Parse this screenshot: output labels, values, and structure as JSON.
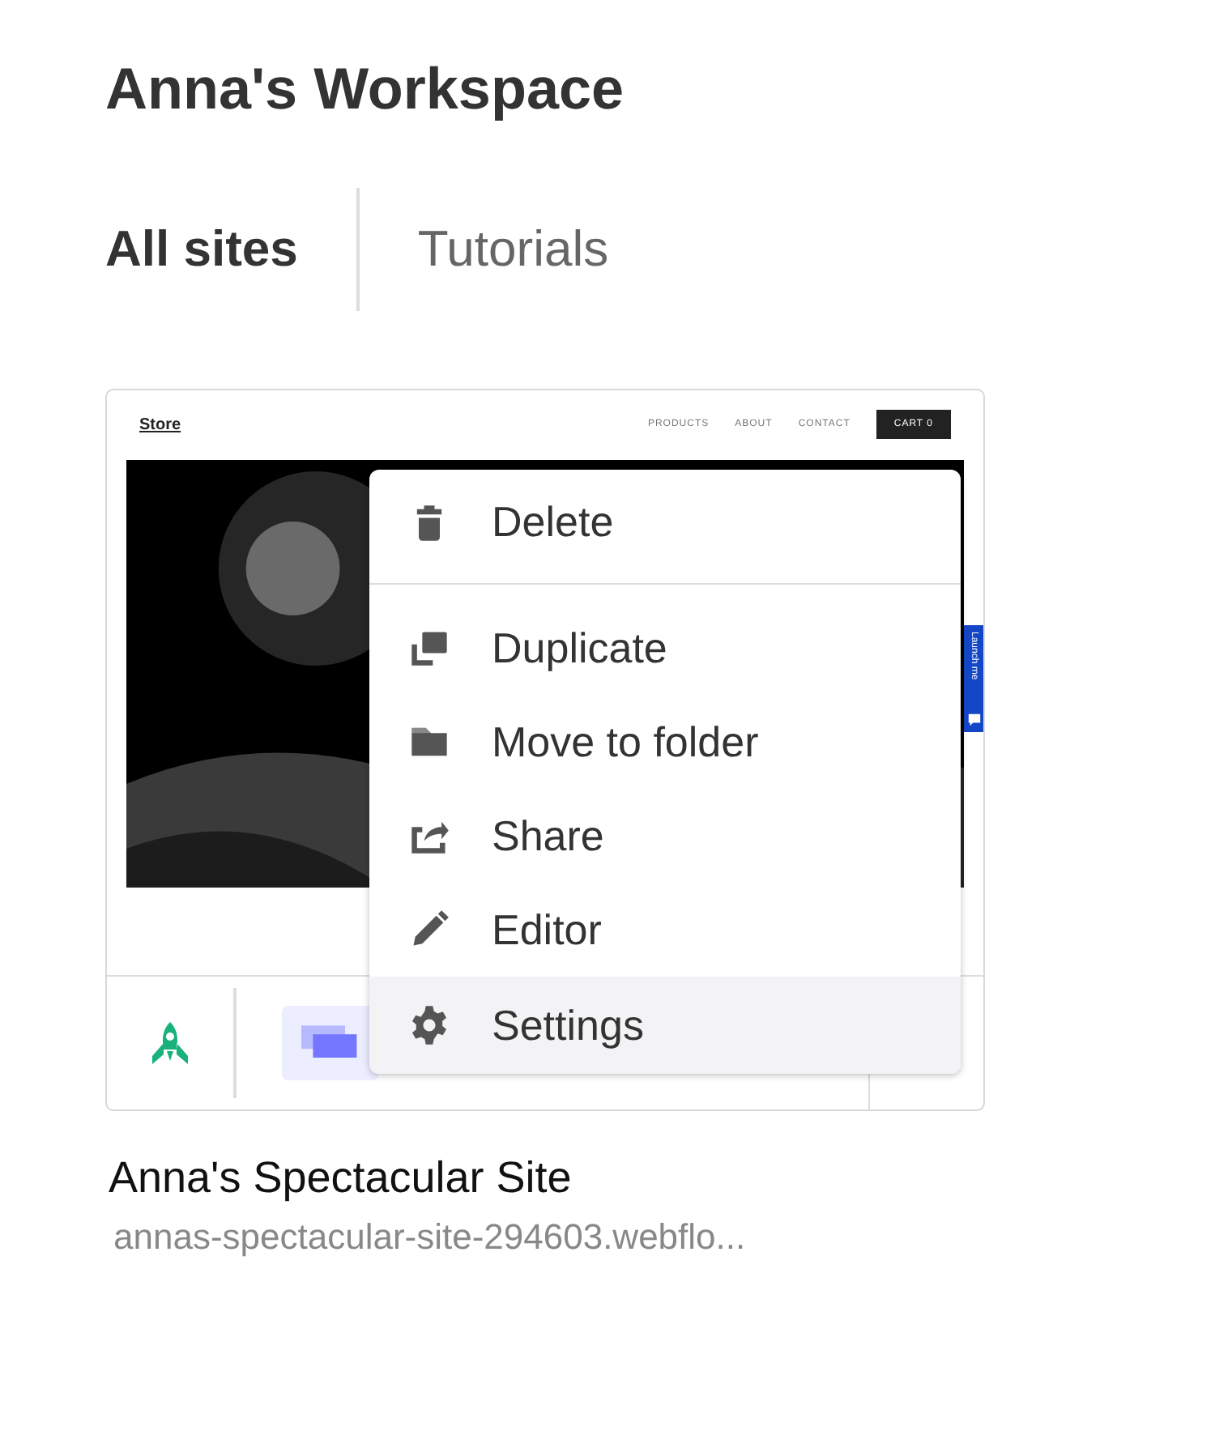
{
  "workspace": {
    "title": "Anna's Workspace"
  },
  "tabs": [
    {
      "label": "All sites",
      "selected": true
    },
    {
      "label": "Tutorials",
      "selected": false
    }
  ],
  "site_card": {
    "preview": {
      "logo": "Store",
      "nav": [
        "PRODUCTS",
        "ABOUT",
        "CONTACT"
      ],
      "cart": "CART 0",
      "badge": "Launch me"
    },
    "name": "Anna's Spectacular Site",
    "url": "annas-spectacular-site-294603.webflo..."
  },
  "context_menu": [
    {
      "kind": "delete",
      "label": "Delete",
      "selected": false,
      "divider_after": true
    },
    {
      "kind": "duplicate",
      "label": "Duplicate",
      "selected": false,
      "divider_after": false
    },
    {
      "kind": "folder",
      "label": "Move to folder",
      "selected": false,
      "divider_after": false
    },
    {
      "kind": "share",
      "label": "Share",
      "selected": false,
      "divider_after": false
    },
    {
      "kind": "editor",
      "label": "Editor",
      "selected": false,
      "divider_after": false
    },
    {
      "kind": "settings",
      "label": "Settings",
      "selected": true,
      "divider_after": false
    }
  ]
}
